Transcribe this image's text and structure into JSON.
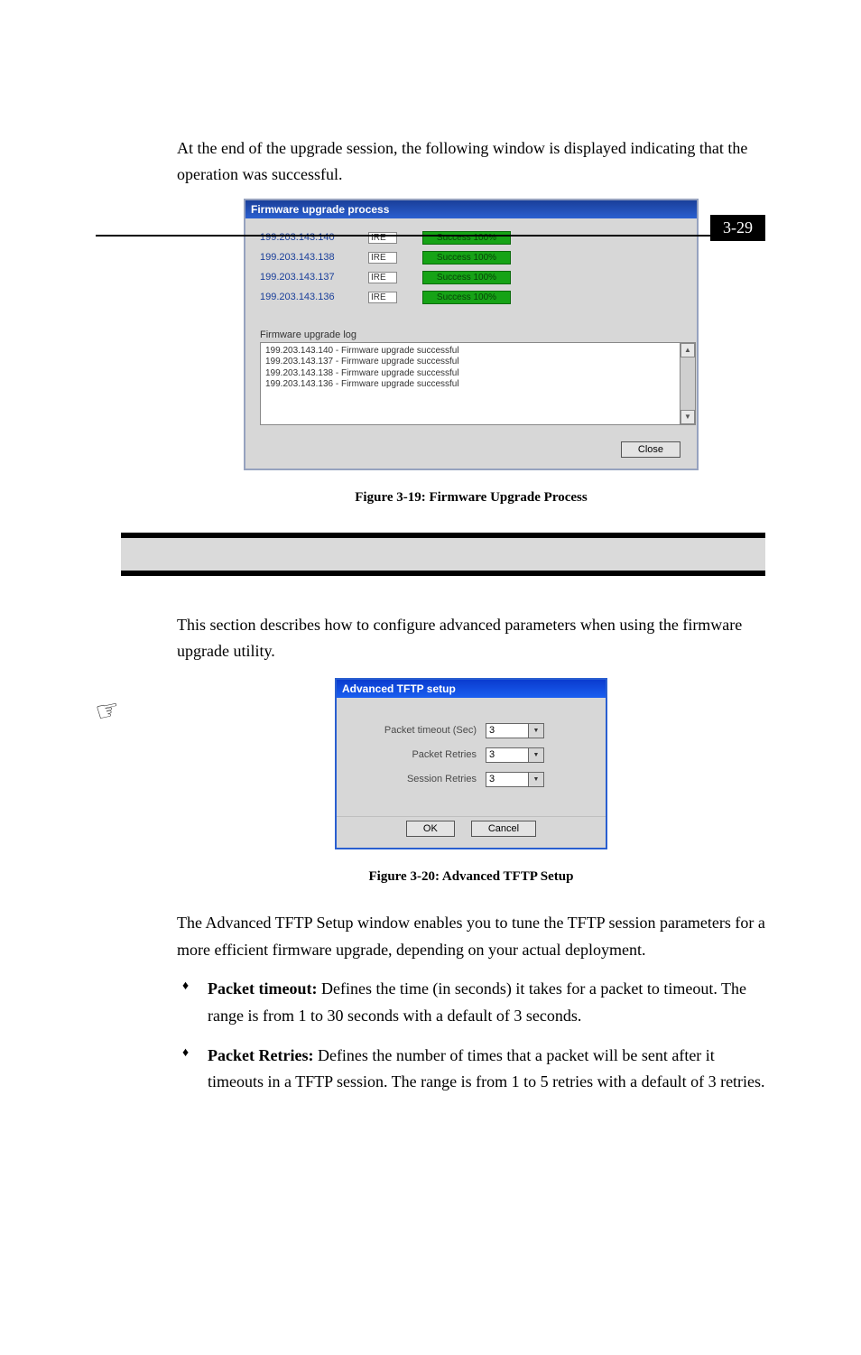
{
  "page_number": "3-29",
  "intro_text": "At the end of the upgrade session, the following window is displayed indicating that the operation was successful.",
  "fw_window": {
    "title": "Firmware upgrade process",
    "rows": [
      {
        "ip": "199.203.143.140",
        "ire": "IRE",
        "status": "Success 100%"
      },
      {
        "ip": "199.203.143.138",
        "ire": "IRE",
        "status": "Success 100%"
      },
      {
        "ip": "199.203.143.137",
        "ire": "IRE",
        "status": "Success 100%"
      },
      {
        "ip": "199.203.143.136",
        "ire": "IRE",
        "status": "Success 100%"
      }
    ],
    "log_label": "Firmware upgrade log",
    "log_lines": [
      "199.203.143.140 - Firmware upgrade successful",
      "199.203.143.137 - Firmware upgrade successful",
      "199.203.143.138 - Firmware upgrade successful",
      "199.203.143.136 - Firmware upgrade successful"
    ],
    "close_btn": "Close"
  },
  "fig1_caption": "Figure 3-19: Firmware Upgrade Process",
  "section2_intro": "This section describes how to configure advanced parameters when using the firmware upgrade utility.",
  "tftp_dialog": {
    "title": "Advanced TFTP setup",
    "fields": [
      {
        "label": "Packet timeout (Sec)",
        "value": "3"
      },
      {
        "label": "Packet Retries",
        "value": "3"
      },
      {
        "label": "Session Retries",
        "value": "3"
      }
    ],
    "ok": "OK",
    "cancel": "Cancel"
  },
  "fig2_caption": "Figure 3-20: Advanced TFTP Setup",
  "para2": "The Advanced TFTP Setup window enables you to tune the TFTP session parameters for a more efficient firmware upgrade, depending on your actual deployment.",
  "bullets": [
    {
      "b": "Packet timeout:",
      "t": " Defines the time (in seconds) it takes for a packet to timeout. The range is from 1 to 30 seconds with a default of 3 seconds."
    },
    {
      "b": "Packet Retries:",
      "t": " Defines the number of times that a packet will be sent after it timeouts in a TFTP session. The range is from 1 to 5 retries with a default of 3 retries."
    }
  ]
}
